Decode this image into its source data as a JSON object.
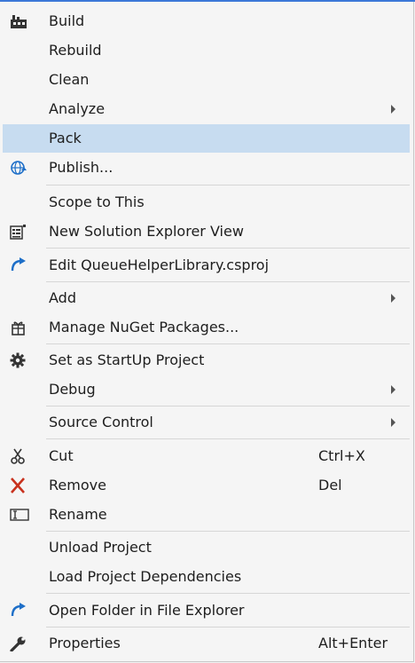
{
  "menu": {
    "build": "Build",
    "rebuild": "Rebuild",
    "clean": "Clean",
    "analyze": "Analyze",
    "pack": "Pack",
    "publish": "Publish...",
    "scope_to_this": "Scope to This",
    "new_solution_explorer_view": "New Solution Explorer View",
    "edit_project": "Edit QueueHelperLibrary.csproj",
    "add": "Add",
    "manage_nuget": "Manage NuGet Packages...",
    "set_startup": "Set as StartUp Project",
    "debug": "Debug",
    "source_control": "Source Control",
    "cut": "Cut",
    "cut_shortcut": "Ctrl+X",
    "remove": "Remove",
    "remove_shortcut": "Del",
    "rename": "Rename",
    "unload_project": "Unload Project",
    "load_project_dependencies": "Load Project Dependencies",
    "open_folder": "Open Folder in File Explorer",
    "properties": "Properties",
    "properties_shortcut": "Alt+Enter"
  },
  "colors": {
    "highlight": "#c7dcf0",
    "accent_blue": "#1e6fc8",
    "remove_red": "#c8321e"
  },
  "icons": {
    "build": "build-icon",
    "publish": "globe-publish-icon",
    "new_view": "solution-explorer-view-icon",
    "edit": "edit-arrow-icon",
    "nuget": "nuget-package-icon",
    "startup": "gear-icon",
    "cut": "scissors-icon",
    "remove": "remove-x-icon",
    "rename": "rename-icon",
    "open_folder": "open-folder-arrow-icon",
    "properties": "wrench-icon"
  }
}
